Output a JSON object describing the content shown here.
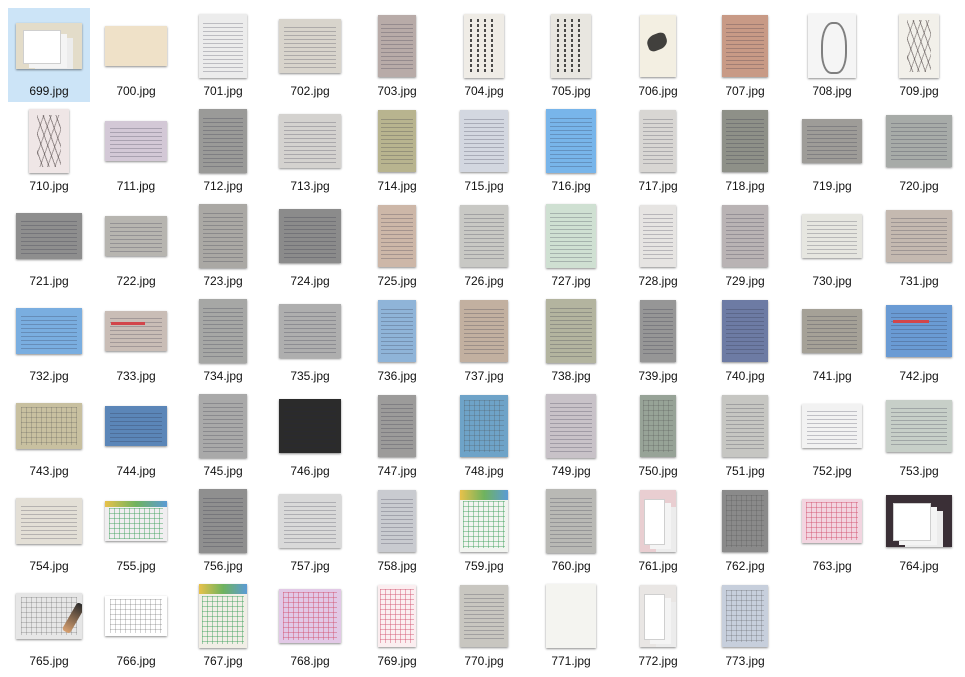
{
  "view": {
    "selected_file": "699.jpg",
    "colors": {
      "background": "#ffffff",
      "selection": "#cce4f7",
      "label_text": "#111111"
    }
  },
  "files": [
    {
      "name": "699.jpg",
      "thumb": {
        "bg": "#e3dcc9",
        "style": "stack"
      },
      "selected": true
    },
    {
      "name": "700.jpg",
      "thumb": {
        "bg": "#efe1c8",
        "style": "plain"
      }
    },
    {
      "name": "701.jpg",
      "thumb": {
        "bg": "#ececec",
        "style": "lines"
      }
    },
    {
      "name": "702.jpg",
      "thumb": {
        "bg": "#d8d4cc",
        "style": "lines"
      }
    },
    {
      "name": "703.jpg",
      "thumb": {
        "bg": "#b8aba8",
        "style": "lines"
      }
    },
    {
      "name": "704.jpg",
      "thumb": {
        "bg": "#efece6",
        "style": "calli"
      }
    },
    {
      "name": "705.jpg",
      "thumb": {
        "bg": "#e8e6e0",
        "style": "calli"
      }
    },
    {
      "name": "706.jpg",
      "thumb": {
        "bg": "#f3efe2",
        "style": "ink"
      }
    },
    {
      "name": "707.jpg",
      "thumb": {
        "bg": "#c89a86",
        "style": "lines"
      }
    },
    {
      "name": "708.jpg",
      "thumb": {
        "bg": "#f5f5f5",
        "style": "owl"
      }
    },
    {
      "name": "709.jpg",
      "thumb": {
        "bg": "#f2f0ea",
        "style": "tree"
      }
    },
    {
      "name": "710.jpg",
      "thumb": {
        "bg": "#efe6e6",
        "style": "tree"
      }
    },
    {
      "name": "711.jpg",
      "thumb": {
        "bg": "#d3c8d6",
        "style": "lines"
      }
    },
    {
      "name": "712.jpg",
      "thumb": {
        "bg": "#9a9a98",
        "style": "lines"
      }
    },
    {
      "name": "713.jpg",
      "thumb": {
        "bg": "#d4d2cf",
        "style": "lines"
      }
    },
    {
      "name": "714.jpg",
      "thumb": {
        "bg": "#b8b48f",
        "style": "lines"
      }
    },
    {
      "name": "715.jpg",
      "thumb": {
        "bg": "#d3d7e0",
        "style": "lines"
      }
    },
    {
      "name": "716.jpg",
      "thumb": {
        "bg": "#78b5ea",
        "style": "lines"
      }
    },
    {
      "name": "717.jpg",
      "thumb": {
        "bg": "#d8d6d3",
        "style": "lines"
      }
    },
    {
      "name": "718.jpg",
      "thumb": {
        "bg": "#8e9088",
        "style": "lines"
      }
    },
    {
      "name": "719.jpg",
      "thumb": {
        "bg": "#9e9c98",
        "style": "lines"
      }
    },
    {
      "name": "720.jpg",
      "thumb": {
        "bg": "#a7aba8",
        "style": "lines"
      }
    },
    {
      "name": "721.jpg",
      "thumb": {
        "bg": "#8e8e8e",
        "style": "lines"
      }
    },
    {
      "name": "722.jpg",
      "thumb": {
        "bg": "#b7b5b0",
        "style": "lines"
      }
    },
    {
      "name": "723.jpg",
      "thumb": {
        "bg": "#aaa8a4",
        "style": "lines"
      }
    },
    {
      "name": "724.jpg",
      "thumb": {
        "bg": "#8b8b8b",
        "style": "lines"
      }
    },
    {
      "name": "725.jpg",
      "thumb": {
        "bg": "#cdb7a8",
        "style": "lines"
      }
    },
    {
      "name": "726.jpg",
      "thumb": {
        "bg": "#c8c8c4",
        "style": "lines"
      }
    },
    {
      "name": "727.jpg",
      "thumb": {
        "bg": "#cfe0d2",
        "style": "lines"
      }
    },
    {
      "name": "728.jpg",
      "thumb": {
        "bg": "#e6e4e2",
        "style": "lines"
      }
    },
    {
      "name": "729.jpg",
      "thumb": {
        "bg": "#b9b3b4",
        "style": "lines"
      }
    },
    {
      "name": "730.jpg",
      "thumb": {
        "bg": "#e6e6e0",
        "style": "lines"
      }
    },
    {
      "name": "731.jpg",
      "thumb": {
        "bg": "#c4b9b0",
        "style": "lines"
      }
    },
    {
      "name": "732.jpg",
      "thumb": {
        "bg": "#7aaee0",
        "style": "lines"
      }
    },
    {
      "name": "733.jpg",
      "thumb": {
        "bg": "#c9bdb6",
        "style": "redlines"
      }
    },
    {
      "name": "734.jpg",
      "thumb": {
        "bg": "#a6a7a5",
        "style": "lines"
      }
    },
    {
      "name": "735.jpg",
      "thumb": {
        "bg": "#aeaeae",
        "style": "lines"
      }
    },
    {
      "name": "736.jpg",
      "thumb": {
        "bg": "#8fb4d8",
        "style": "lines"
      }
    },
    {
      "name": "737.jpg",
      "thumb": {
        "bg": "#c2b0a0",
        "style": "lines"
      }
    },
    {
      "name": "738.jpg",
      "thumb": {
        "bg": "#b3b49f",
        "style": "lines"
      }
    },
    {
      "name": "739.jpg",
      "thumb": {
        "bg": "#969696",
        "style": "lines"
      }
    },
    {
      "name": "740.jpg",
      "thumb": {
        "bg": "#6d7ba4",
        "style": "lines"
      }
    },
    {
      "name": "741.jpg",
      "thumb": {
        "bg": "#a5a197",
        "style": "lines"
      }
    },
    {
      "name": "742.jpg",
      "thumb": {
        "bg": "#6a9bd4",
        "style": "redlines"
      }
    },
    {
      "name": "743.jpg",
      "thumb": {
        "bg": "#c8c0a0",
        "style": "grid"
      }
    },
    {
      "name": "744.jpg",
      "thumb": {
        "bg": "#5b86b8",
        "style": "lines"
      }
    },
    {
      "name": "745.jpg",
      "thumb": {
        "bg": "#a9a9a9",
        "style": "lines"
      }
    },
    {
      "name": "746.jpg",
      "thumb": {
        "bg": "#2b2b2b",
        "style": "lines"
      }
    },
    {
      "name": "747.jpg",
      "thumb": {
        "bg": "#9c9b9a",
        "style": "lines"
      }
    },
    {
      "name": "748.jpg",
      "thumb": {
        "bg": "#6ea3c8",
        "style": "grid"
      }
    },
    {
      "name": "749.jpg",
      "thumb": {
        "bg": "#c8c2c8",
        "style": "lines"
      }
    },
    {
      "name": "750.jpg",
      "thumb": {
        "bg": "#97a397",
        "style": "grid"
      }
    },
    {
      "name": "751.jpg",
      "thumb": {
        "bg": "#c6c6c2",
        "style": "lines"
      }
    },
    {
      "name": "752.jpg",
      "thumb": {
        "bg": "#f2f2f2",
        "style": "lines"
      }
    },
    {
      "name": "753.jpg",
      "thumb": {
        "bg": "#c7cfc8",
        "style": "lines"
      }
    },
    {
      "name": "754.jpg",
      "thumb": {
        "bg": "#e3dfd6",
        "style": "lines"
      }
    },
    {
      "name": "755.jpg",
      "thumb": {
        "bg": "#f0eef0",
        "style": "greengrid"
      }
    },
    {
      "name": "756.jpg",
      "thumb": {
        "bg": "#8f8f8f",
        "style": "lines"
      }
    },
    {
      "name": "757.jpg",
      "thumb": {
        "bg": "#d9d9d9",
        "style": "lines"
      }
    },
    {
      "name": "758.jpg",
      "thumb": {
        "bg": "#c9cbd0",
        "style": "lines"
      }
    },
    {
      "name": "759.jpg",
      "thumb": {
        "bg": "#f2f4f0",
        "style": "greengrid"
      }
    },
    {
      "name": "760.jpg",
      "thumb": {
        "bg": "#b9b9b5",
        "style": "lines"
      }
    },
    {
      "name": "761.jpg",
      "thumb": {
        "bg": "#e9ced1",
        "style": "stack"
      }
    },
    {
      "name": "762.jpg",
      "thumb": {
        "bg": "#8a8a8a",
        "style": "grid"
      }
    },
    {
      "name": "763.jpg",
      "thumb": {
        "bg": "#f2d5e0",
        "style": "redgrid"
      }
    },
    {
      "name": "764.jpg",
      "thumb": {
        "bg": "#3a2f36",
        "style": "stack"
      }
    },
    {
      "name": "765.jpg",
      "thumb": {
        "bg": "#e6e6e6",
        "style": "pen"
      }
    },
    {
      "name": "766.jpg",
      "thumb": {
        "bg": "#ffffff",
        "style": "grid"
      }
    },
    {
      "name": "767.jpg",
      "thumb": {
        "bg": "#f1eee6",
        "style": "greengrid"
      }
    },
    {
      "name": "768.jpg",
      "thumb": {
        "bg": "#e2c9e6",
        "style": "redgrid"
      }
    },
    {
      "name": "769.jpg",
      "thumb": {
        "bg": "#fbeef0",
        "style": "redgrid"
      }
    },
    {
      "name": "770.jpg",
      "thumb": {
        "bg": "#c8c6c0",
        "style": "lines"
      }
    },
    {
      "name": "771.jpg",
      "thumb": {
        "bg": "#f4f4f0",
        "style": "plain"
      }
    },
    {
      "name": "772.jpg",
      "thumb": {
        "bg": "#e9e6e4",
        "style": "stack"
      }
    },
    {
      "name": "773.jpg",
      "thumb": {
        "bg": "#c7cfdc",
        "style": "grid"
      }
    }
  ]
}
